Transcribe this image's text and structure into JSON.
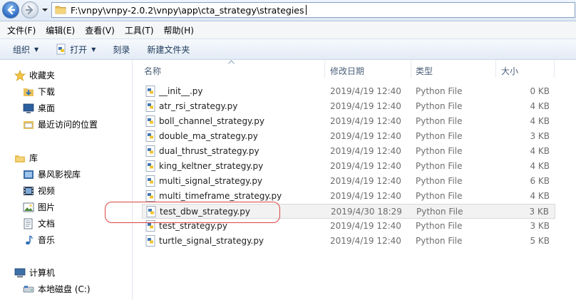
{
  "address": {
    "path": "F:\\vnpy\\vnpy-2.0.2\\vnpy\\app\\cta_strategy\\strategies"
  },
  "menu": [
    {
      "label": "文件(F)"
    },
    {
      "label": "编辑(E)"
    },
    {
      "label": "查看(V)"
    },
    {
      "label": "工具(T)"
    },
    {
      "label": "帮助(H)"
    }
  ],
  "toolbar": {
    "organize": "组织",
    "open": "打开",
    "burn": "刻录",
    "new_folder": "新建文件夹"
  },
  "nav": {
    "favorites": "收藏夹",
    "downloads": "下载",
    "desktop": "桌面",
    "recent": "最近访问的位置",
    "libraries": "库",
    "storm": "暴风影视库",
    "videos": "视频",
    "pictures": "图片",
    "documents": "文档",
    "music": "音乐",
    "computer": "计算机",
    "local_disk": "本地磁盘 (C:)"
  },
  "columns": {
    "name": "名称",
    "modified": "修改日期",
    "type": "类型",
    "size": "大小"
  },
  "files": [
    {
      "name": "__init__.py",
      "modified": "2019/4/19 12:40",
      "type": "Python File",
      "size": "0 KB"
    },
    {
      "name": "atr_rsi_strategy.py",
      "modified": "2019/4/19 12:40",
      "type": "Python File",
      "size": "4 KB"
    },
    {
      "name": "boll_channel_strategy.py",
      "modified": "2019/4/19 12:40",
      "type": "Python File",
      "size": "4 KB"
    },
    {
      "name": "double_ma_strategy.py",
      "modified": "2019/4/19 12:40",
      "type": "Python File",
      "size": "3 KB"
    },
    {
      "name": "dual_thrust_strategy.py",
      "modified": "2019/4/19 12:40",
      "type": "Python File",
      "size": "4 KB"
    },
    {
      "name": "king_keltner_strategy.py",
      "modified": "2019/4/19 12:40",
      "type": "Python File",
      "size": "4 KB"
    },
    {
      "name": "multi_signal_strategy.py",
      "modified": "2019/4/19 12:40",
      "type": "Python File",
      "size": "6 KB"
    },
    {
      "name": "multi_timeframe_strategy.py",
      "modified": "2019/4/19 12:40",
      "type": "Python File",
      "size": "4 KB"
    },
    {
      "name": "test_dbw_strategy.py",
      "modified": "2019/4/30 18:29",
      "type": "Python File",
      "size": "3 KB",
      "highlighted": true
    },
    {
      "name": "test_strategy.py",
      "modified": "2019/4/19 12:40",
      "type": "Python File",
      "size": "3 KB"
    },
    {
      "name": "turtle_signal_strategy.py",
      "modified": "2019/4/19 12:40",
      "type": "Python File",
      "size": "5 KB"
    }
  ],
  "colors": {
    "highlight_bg": "#f2f2f2",
    "annotation": "#d9453f",
    "accent": "#1e395b"
  }
}
